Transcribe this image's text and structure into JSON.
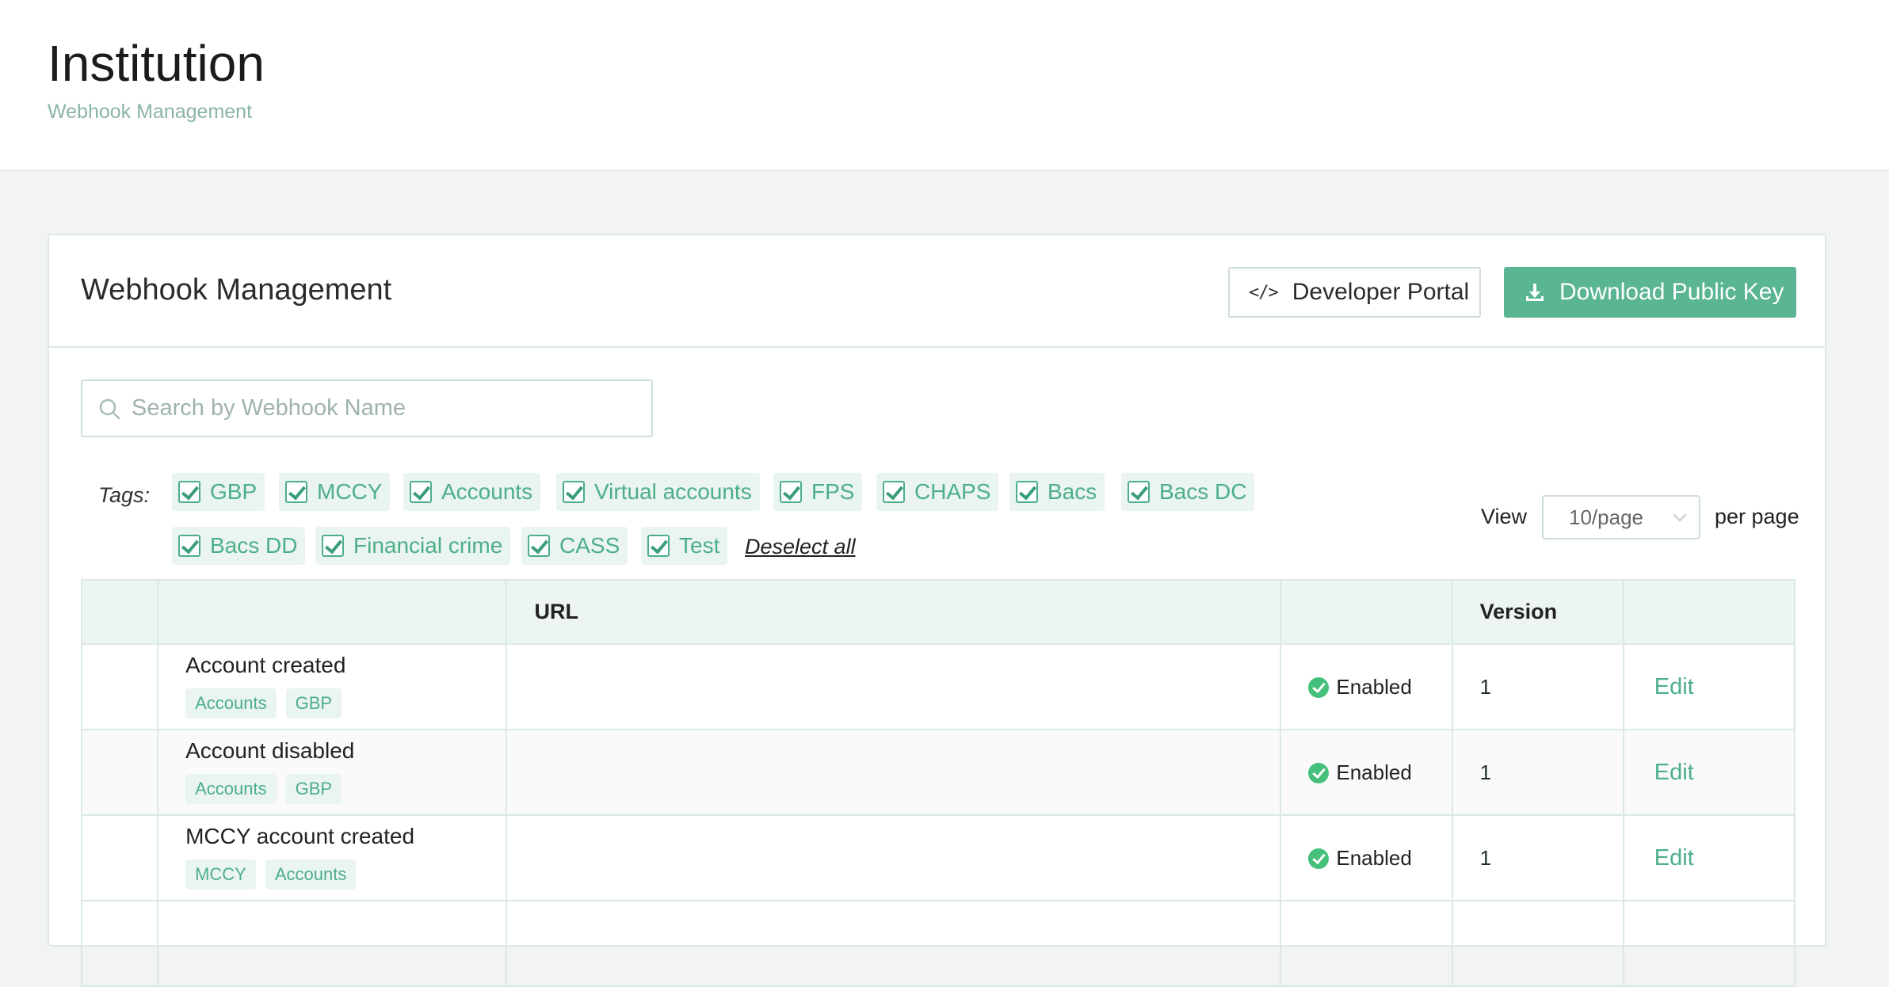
{
  "header": {
    "title": "Institution",
    "subtitle": "Webhook Management"
  },
  "card": {
    "title": "Webhook Management",
    "developer_portal_label": "Developer Portal",
    "download_key_label": "Download Public Key"
  },
  "search": {
    "placeholder": "Search by Webhook Name",
    "value": ""
  },
  "tags": {
    "label": "Tags:",
    "items": [
      {
        "label": "GBP",
        "checked": true
      },
      {
        "label": "MCCY",
        "checked": true
      },
      {
        "label": "Accounts",
        "checked": true
      },
      {
        "label": "Virtual accounts",
        "checked": true
      },
      {
        "label": "FPS",
        "checked": true
      },
      {
        "label": "CHAPS",
        "checked": true
      },
      {
        "label": "Bacs",
        "checked": true
      },
      {
        "label": "Bacs DC",
        "checked": true
      },
      {
        "label": "Bacs DD",
        "checked": true
      },
      {
        "label": "Financial crime",
        "checked": true
      },
      {
        "label": "CASS",
        "checked": true
      },
      {
        "label": "Test",
        "checked": true
      }
    ],
    "deselect_all": "Deselect all"
  },
  "pagination": {
    "view_label": "View",
    "selected": "10/page",
    "per_page_label": "per page"
  },
  "table": {
    "columns": [
      "",
      "",
      "URL",
      "",
      "Version",
      ""
    ],
    "rows": [
      {
        "name": "Account created",
        "tags": [
          "Accounts",
          "GBP"
        ],
        "url": "",
        "status": "Enabled",
        "version": "1",
        "action": "Edit"
      },
      {
        "name": "Account disabled",
        "tags": [
          "Accounts",
          "GBP"
        ],
        "url": "",
        "status": "Enabled",
        "version": "1",
        "action": "Edit"
      },
      {
        "name": "MCCY account created",
        "tags": [
          "MCCY",
          "Accounts"
        ],
        "url": "",
        "status": "Enabled",
        "version": "1",
        "action": "Edit"
      }
    ]
  },
  "colors": {
    "accent": "#5ab592",
    "tag_text": "#4caf88",
    "tag_bg": "#eaf4f1",
    "status_ok": "#45c07a"
  }
}
